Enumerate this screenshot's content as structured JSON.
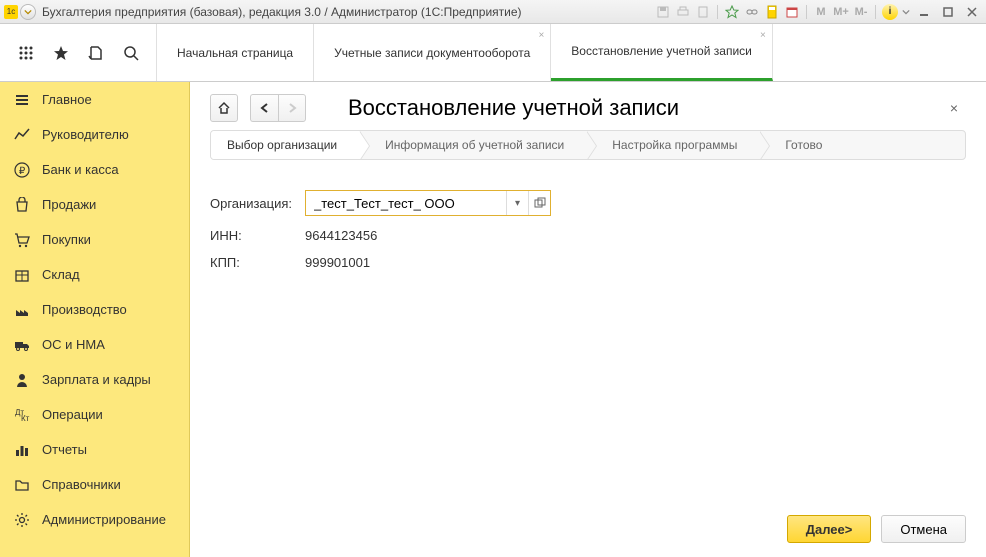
{
  "titlebar": {
    "app_title": "Бухгалтерия предприятия (базовая), редакция 3.0 / Администратор  (1С:Предприятие)",
    "logo_text": "1c"
  },
  "tabs": {
    "home": "Начальная страница",
    "tab1": "Учетные записи документооборота",
    "tab2": "Восстановление учетной записи"
  },
  "sidebar": {
    "items": [
      {
        "label": "Главное"
      },
      {
        "label": "Руководителю"
      },
      {
        "label": "Банк и касса"
      },
      {
        "label": "Продажи"
      },
      {
        "label": "Покупки"
      },
      {
        "label": "Склад"
      },
      {
        "label": "Производство"
      },
      {
        "label": "ОС и НМА"
      },
      {
        "label": "Зарплата и кадры"
      },
      {
        "label": "Операции"
      },
      {
        "label": "Отчеты"
      },
      {
        "label": "Справочники"
      },
      {
        "label": "Администрирование"
      }
    ]
  },
  "page": {
    "title": "Восстановление учетной записи"
  },
  "steps": {
    "s1": "Выбор организации",
    "s2": "Информация об учетной записи",
    "s3": "Настройка программы",
    "s4": "Готово"
  },
  "form": {
    "org_label": "Организация:",
    "org_value": "_тест_Тест_тест_ ООО",
    "inn_label": "ИНН:",
    "inn_value": "9644123456",
    "kpp_label": "КПП:",
    "kpp_value": "999901001"
  },
  "footer": {
    "next": "Далее>",
    "cancel": "Отмена"
  },
  "m_buttons": {
    "m": "M",
    "mplus": "M+",
    "mminus": "M-",
    "info": "i"
  }
}
